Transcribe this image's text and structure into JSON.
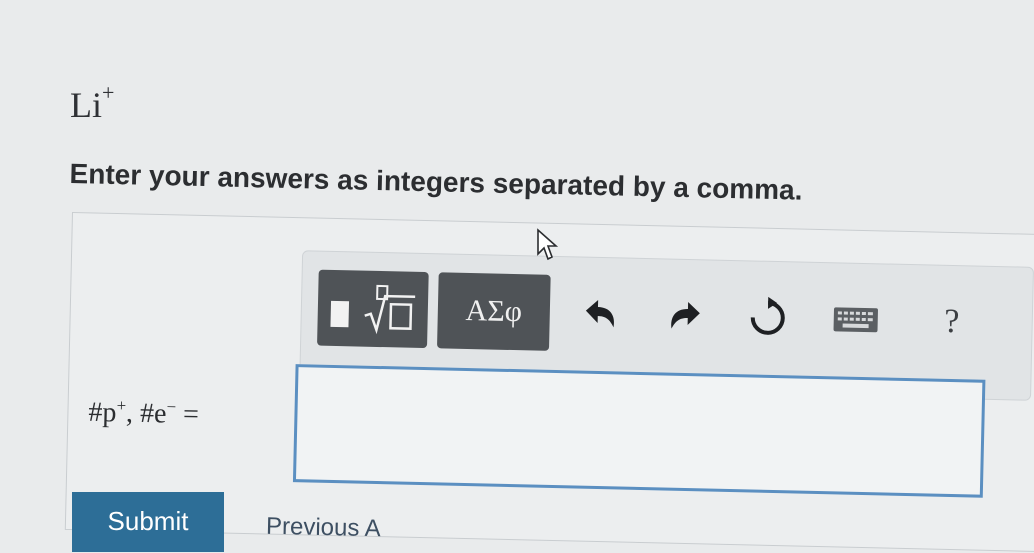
{
  "question": {
    "species_symbol": "Li",
    "species_charge": "+",
    "instruction": "Enter your answers as integers separated by a comma."
  },
  "toolbar": {
    "greek_label": "ΑΣφ",
    "help_label": "?"
  },
  "answer": {
    "label_p": "#p",
    "label_p_sup": "+",
    "label_sep": ", ",
    "label_e": "#e",
    "label_e_sup": "−",
    "label_eq": " =",
    "value": ""
  },
  "footer": {
    "submit_label": "Submit",
    "previous_label": "Previous A"
  }
}
